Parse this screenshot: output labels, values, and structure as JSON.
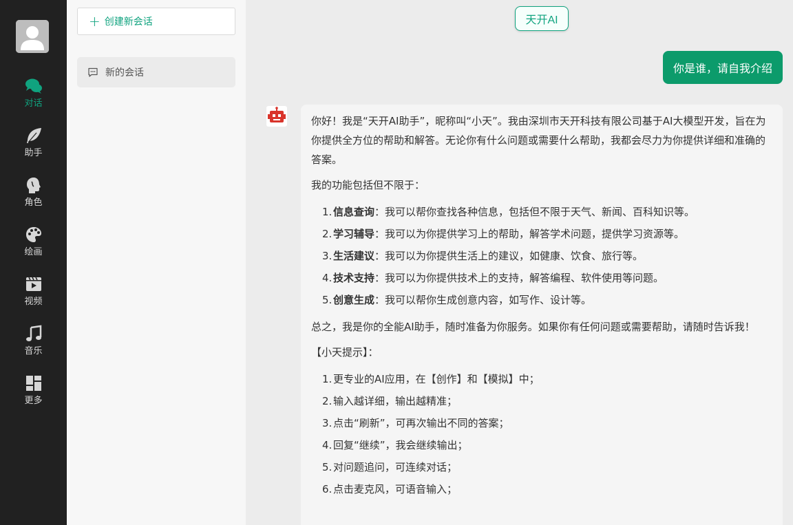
{
  "nav": {
    "items": [
      {
        "label": "对话",
        "icon": "chat-icon"
      },
      {
        "label": "助手",
        "icon": "feather-icon"
      },
      {
        "label": "角色",
        "icon": "head-profile-icon"
      },
      {
        "label": "绘画",
        "icon": "palette-icon"
      },
      {
        "label": "视频",
        "icon": "video-icon"
      },
      {
        "label": "音乐",
        "icon": "music-note-icon"
      },
      {
        "label": "更多",
        "icon": "grid-icon"
      }
    ],
    "active_color": "#10a37f"
  },
  "conversations": {
    "new_button_label": "创建新会话",
    "items": [
      {
        "title": "新的会话"
      }
    ]
  },
  "chat": {
    "model_name": "天开AI",
    "user_message": "你是谁，请自我介绍",
    "bot_reply": {
      "intro": "你好！我是“天开AI助手”，昵称叫“小天”。我由深圳市天开科技有限公司基于AI大模型开发，旨在为你提供全方位的帮助和解答。无论你有什么问题或需要什么帮助，我都会尽力为你提供详细和准确的答案。",
      "features_heading": "我的功能包括但不限于：",
      "features": [
        {
          "num": "1.",
          "title": "信息查询",
          "text": "：我可以帮你查找各种信息，包括但不限于天气、新闻、百科知识等。"
        },
        {
          "num": "2.",
          "title": "学习辅导",
          "text": "：我可以为你提供学习上的帮助，解答学术问题，提供学习资源等。"
        },
        {
          "num": "3.",
          "title": "生活建议",
          "text": "：我可以为你提供生活上的建议，如健康、饮食、旅行等。"
        },
        {
          "num": "4.",
          "title": "技术支持",
          "text": "：我可以为你提供技术上的支持，解答编程、软件使用等问题。"
        },
        {
          "num": "5.",
          "title": "创意生成",
          "text": "：我可以帮你生成创意内容，如写作、设计等。"
        }
      ],
      "summary": "总之，我是你的全能AI助手，随时准备为你服务。如果你有任何问题或需要帮助，请随时告诉我！",
      "tips_heading": "【小天提示】：",
      "tips": [
        {
          "num": "1.",
          "text": "更专业的AI应用，在【创作】和【模拟】中；"
        },
        {
          "num": "2.",
          "text": "输入越详细，输出越精准；"
        },
        {
          "num": "3.",
          "text": "点击“刷新”，可再次输出不同的答案；"
        },
        {
          "num": "4.",
          "text": "回复“继续”，我会继续输出；"
        },
        {
          "num": "5.",
          "text": "对问题追问，可连续对话；"
        },
        {
          "num": "6.",
          "text": "点击麦克风，可语音输入；"
        }
      ]
    },
    "user_bubble_color": "#0c9b6b",
    "bot_avatar_color": "#d9342b"
  }
}
